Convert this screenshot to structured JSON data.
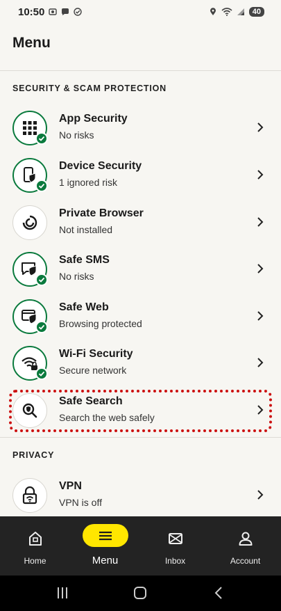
{
  "status_bar": {
    "time": "10:50",
    "battery": "40"
  },
  "page_title": "Menu",
  "sections": [
    {
      "header": "SECURITY & SCAM PROTECTION"
    },
    {
      "header": "PRIVACY"
    }
  ],
  "items": [
    {
      "title": "App Security",
      "subtitle": "No risks",
      "icon": "apps-grid-icon",
      "protected": true
    },
    {
      "title": "Device Security",
      "subtitle": "1 ignored risk",
      "icon": "phone-shield-icon",
      "protected": true
    },
    {
      "title": "Private Browser",
      "subtitle": "Not installed",
      "icon": "private-browser-icon",
      "protected": false
    },
    {
      "title": "Safe SMS",
      "subtitle": "No risks",
      "icon": "sms-shield-icon",
      "protected": true
    },
    {
      "title": "Safe Web",
      "subtitle": "Browsing protected",
      "icon": "web-shield-icon",
      "protected": true
    },
    {
      "title": "Wi-Fi Security",
      "subtitle": "Secure network",
      "icon": "wifi-lock-icon",
      "protected": true
    },
    {
      "title": "Safe Search",
      "subtitle": "Search the web safely",
      "icon": "search-shield-icon",
      "protected": false
    },
    {
      "title": "VPN",
      "subtitle": "VPN is off",
      "icon": "padlock-wifi-icon",
      "protected": false
    }
  ],
  "bottom_nav": [
    {
      "label": "Home",
      "icon": "home-icon"
    },
    {
      "label": "Menu",
      "icon": "hamburger-icon",
      "active": true
    },
    {
      "label": "Inbox",
      "icon": "mail-icon"
    },
    {
      "label": "Account",
      "icon": "user-icon"
    }
  ],
  "colors": {
    "accent_green": "#0a7a3d",
    "accent_yellow": "#ffe600",
    "highlight_red": "#cc1010",
    "nav_bg": "#232323"
  }
}
